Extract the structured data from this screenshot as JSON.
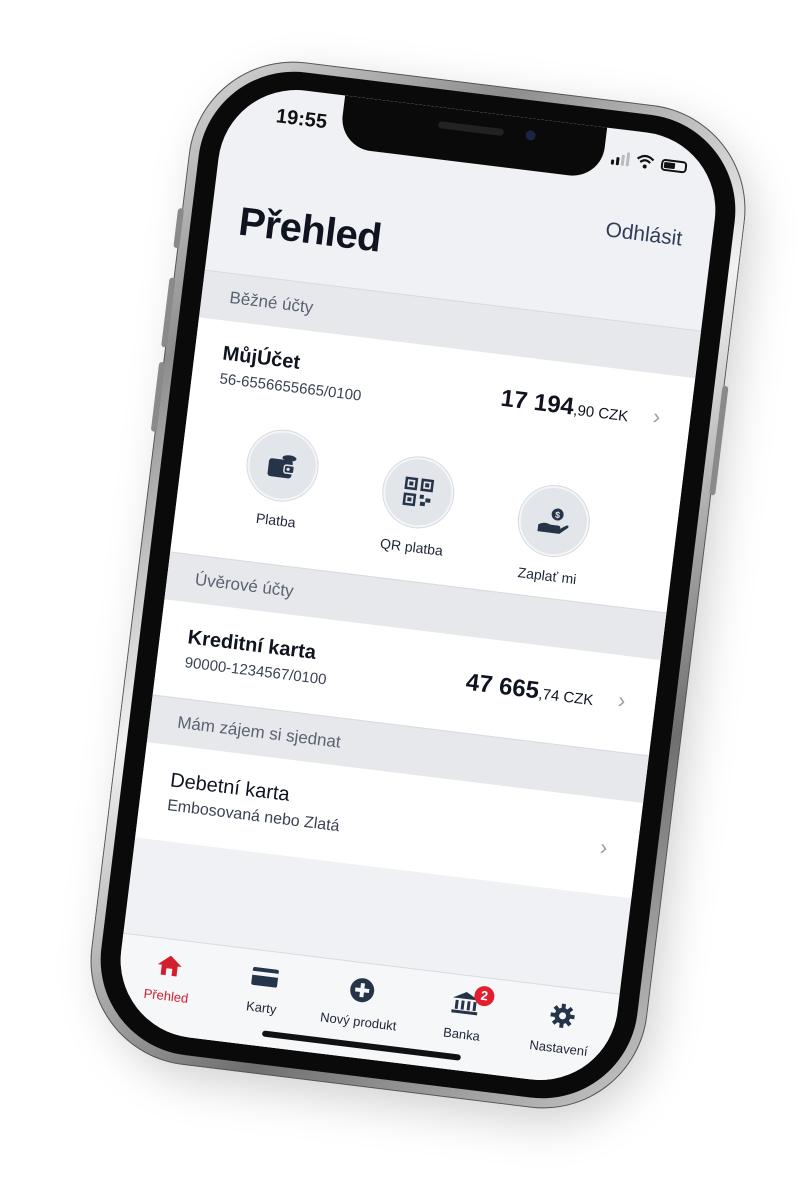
{
  "status_bar": {
    "time": "19:55"
  },
  "header": {
    "logout_label": "Odhlásit",
    "title": "Přehled"
  },
  "sections": {
    "current": {
      "title": "Běžné účty",
      "account": {
        "name": "MůjÚčet",
        "number": "56-6556655665/0100",
        "amount_main": "17 194",
        "amount_decimal": ",90 CZK"
      },
      "actions": [
        {
          "label": "Platba",
          "icon": "wallet-icon"
        },
        {
          "label": "QR platba",
          "icon": "qr-code-icon"
        },
        {
          "label": "Zaplať mi",
          "icon": "hand-coin-icon"
        }
      ]
    },
    "credit": {
      "title": "Úvěrové účty",
      "account": {
        "name": "Kreditní karta",
        "number": "90000-1234567/0100",
        "amount_main": "47 665",
        "amount_decimal": ",74 CZK"
      }
    },
    "offers": {
      "title": "Mám zájem si sjednat",
      "item": {
        "name": "Debetní karta",
        "subtitle": "Embosovaná nebo Zlatá"
      }
    }
  },
  "tabbar": {
    "items": [
      {
        "label": "Přehled",
        "icon": "home-icon",
        "active": true
      },
      {
        "label": "Karty",
        "icon": "card-icon"
      },
      {
        "label": "Nový produkt",
        "icon": "plus-circle-icon"
      },
      {
        "label": "Banka",
        "icon": "bank-icon",
        "badge": "2"
      },
      {
        "label": "Nastavení",
        "icon": "gear-icon"
      }
    ]
  },
  "colors": {
    "accent": "#d21f2f",
    "navy": "#2e3e58",
    "badge": "#e21f2e"
  }
}
